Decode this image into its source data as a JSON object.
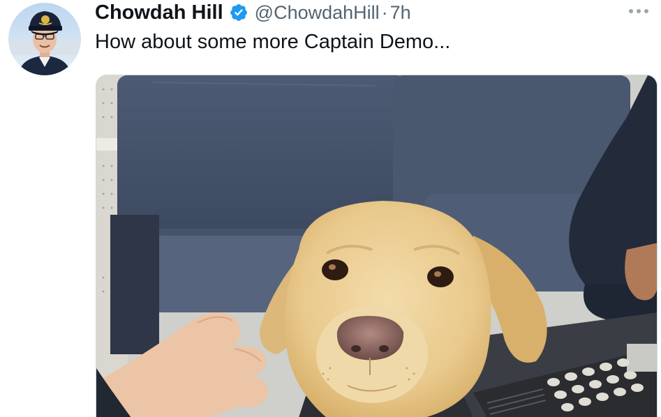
{
  "tweet": {
    "author_name": "Chowdah Hill",
    "author_handle": "@ChowdahHill",
    "separator": "·",
    "timestamp": "7h",
    "text": "How about some more Captain Demo...",
    "verified": true
  },
  "icons": {
    "verified": "verified-badge-icon",
    "more": "more-options-icon"
  },
  "colors": {
    "verified_blue": "#1d9bf0",
    "secondary_text": "#536471",
    "primary_text": "#0f1419"
  }
}
